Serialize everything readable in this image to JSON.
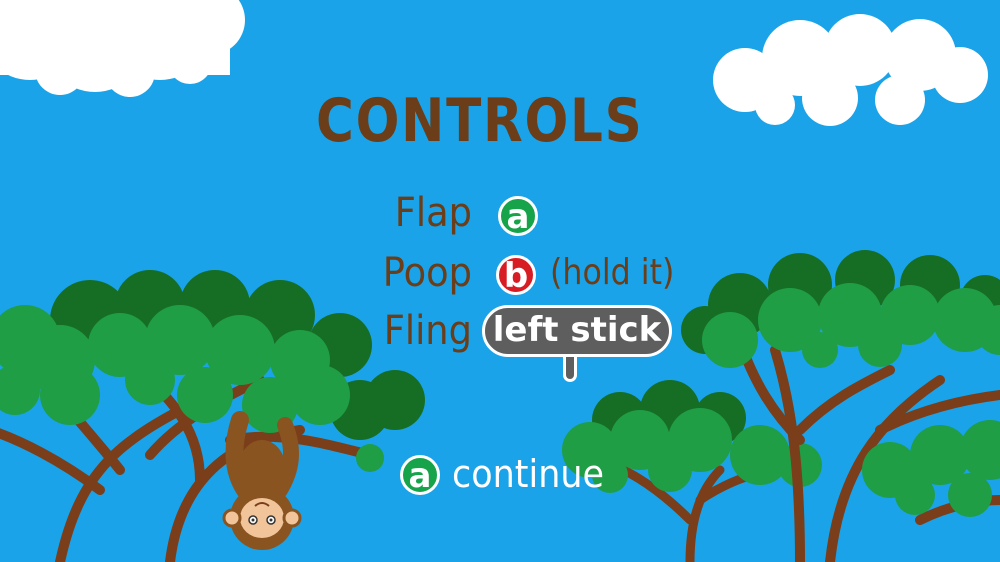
{
  "screen": {
    "title": "CONTROLS",
    "sky_color": "#1aa3e8",
    "text_color": "#6b3d18"
  },
  "controls": [
    {
      "action": "Flap",
      "input": "a",
      "input_type": "button",
      "input_color": "#16a34a",
      "extra": ""
    },
    {
      "action": "Poop",
      "input": "b",
      "input_type": "button",
      "input_color": "#d81c24",
      "extra": "(hold it)"
    },
    {
      "action": "Fling",
      "input": "left stick",
      "input_type": "stick",
      "input_color": "#5e5e5e",
      "extra": ""
    }
  ],
  "continue_prompt": {
    "button": "a",
    "label": "continue",
    "button_color": "#16a34a"
  },
  "decor": {
    "clouds": "cloud-icons",
    "trees": "acacia-tree-icons",
    "character": "monkey-icon"
  }
}
